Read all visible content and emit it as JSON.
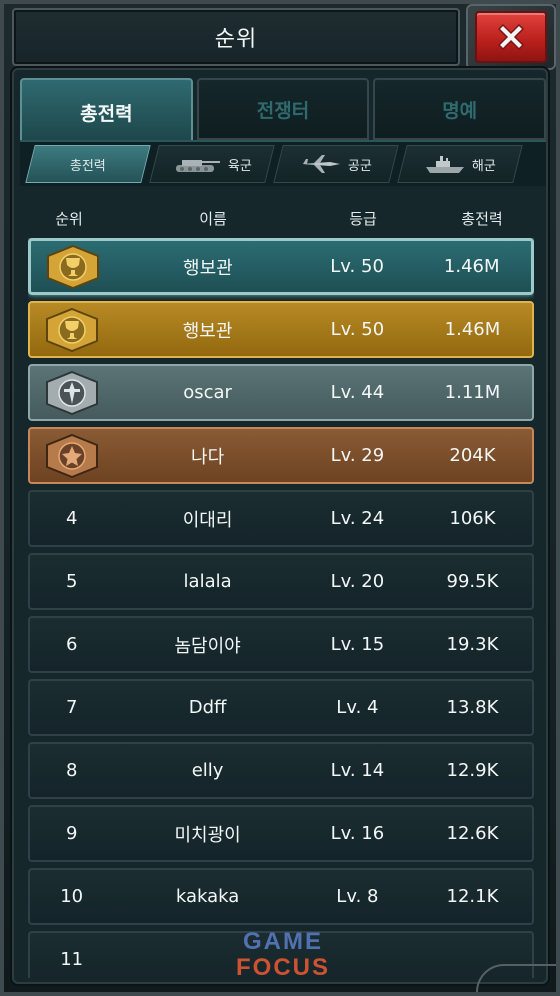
{
  "header": {
    "title": "순위",
    "close_icon": "close-x-icon"
  },
  "tabs": [
    {
      "label": "총전력",
      "active": true
    },
    {
      "label": "전쟁터",
      "active": false
    },
    {
      "label": "명예",
      "active": false
    }
  ],
  "subtabs": [
    {
      "label": "총전력",
      "icon": "",
      "active": true
    },
    {
      "label": "육군",
      "icon": "tank-icon",
      "active": false
    },
    {
      "label": "공군",
      "icon": "jet-icon",
      "active": false
    },
    {
      "label": "해군",
      "icon": "ship-icon",
      "active": false
    }
  ],
  "columns": {
    "rank": "순위",
    "name": "이름",
    "grade": "등급",
    "power": "총전력"
  },
  "rows": [
    {
      "rank": "",
      "medal": "gold-medal-icon",
      "name": "행보관",
      "grade": "Lv. 50",
      "power": "1.46M",
      "style": "mine"
    },
    {
      "rank": "",
      "medal": "gold-medal-icon",
      "name": "행보관",
      "grade": "Lv. 50",
      "power": "1.46M",
      "style": "gold"
    },
    {
      "rank": "",
      "medal": "silver-medal-icon",
      "name": "oscar",
      "grade": "Lv. 44",
      "power": "1.11M",
      "style": "silver"
    },
    {
      "rank": "",
      "medal": "bronze-medal-icon",
      "name": "나다",
      "grade": "Lv. 29",
      "power": "204K",
      "style": "bronze"
    },
    {
      "rank": "4",
      "medal": "",
      "name": "이대리",
      "grade": "Lv. 24",
      "power": "106K",
      "style": "normal"
    },
    {
      "rank": "5",
      "medal": "",
      "name": "lalala",
      "grade": "Lv. 20",
      "power": "99.5K",
      "style": "normal"
    },
    {
      "rank": "6",
      "medal": "",
      "name": "놈담이야",
      "grade": "Lv. 15",
      "power": "19.3K",
      "style": "normal"
    },
    {
      "rank": "7",
      "medal": "",
      "name": "Ddff",
      "grade": "Lv. 4",
      "power": "13.8K",
      "style": "normal"
    },
    {
      "rank": "8",
      "medal": "",
      "name": "elly",
      "grade": "Lv. 14",
      "power": "12.9K",
      "style": "normal"
    },
    {
      "rank": "9",
      "medal": "",
      "name": "미치광이",
      "grade": "Lv. 16",
      "power": "12.6K",
      "style": "normal"
    },
    {
      "rank": "10",
      "medal": "",
      "name": "kakaka",
      "grade": "Lv. 8",
      "power": "12.1K",
      "style": "normal"
    },
    {
      "rank": "11",
      "medal": "",
      "name": "",
      "grade": "",
      "power": "",
      "style": "normal"
    }
  ],
  "watermark": {
    "line1": "GAME",
    "line2": "FOCUS"
  },
  "colors": {
    "accent_teal": "#2f6a70",
    "close_red": "#d2322d",
    "gold_row": "#b88a25",
    "silver_row": "#5b7476",
    "bronze_row": "#8a5b34"
  }
}
